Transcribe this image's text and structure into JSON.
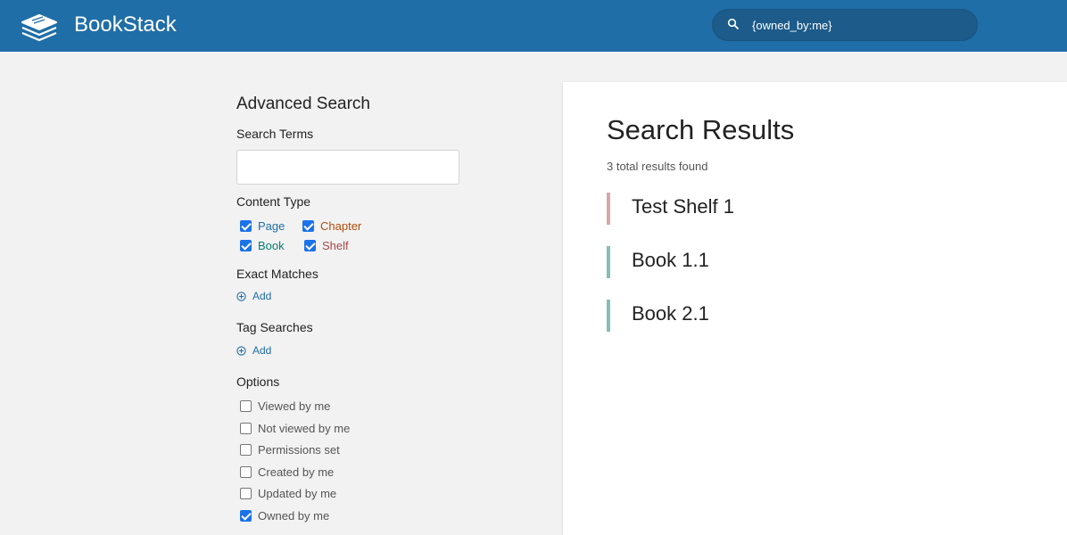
{
  "header": {
    "app_name": "BookStack",
    "search_value": "{owned_by:me}",
    "colors": {
      "header_bg": "#206ea7"
    }
  },
  "sidebar": {
    "title": "Advanced Search",
    "search_terms_label": "Search Terms",
    "search_terms_value": "",
    "content_type_label": "Content Type",
    "content_types": [
      {
        "label": "Page",
        "checked": true,
        "color": "#206ea7"
      },
      {
        "label": "Chapter",
        "checked": true,
        "color": "#af4d0d"
      },
      {
        "label": "Book",
        "checked": true,
        "color": "#077b70"
      },
      {
        "label": "Shelf",
        "checked": true,
        "color": "#a94747"
      }
    ],
    "exact_matches_label": "Exact Matches",
    "exact_add_label": "Add",
    "tag_searches_label": "Tag Searches",
    "tag_add_label": "Add",
    "options_label": "Options",
    "options": [
      {
        "label": "Viewed by me",
        "checked": false
      },
      {
        "label": "Not viewed by me",
        "checked": false
      },
      {
        "label": "Permissions set",
        "checked": false
      },
      {
        "label": "Created by me",
        "checked": false
      },
      {
        "label": "Updated by me",
        "checked": false
      },
      {
        "label": "Owned by me",
        "checked": true
      }
    ]
  },
  "results": {
    "title": "Search Results",
    "count_text": "3 total results found",
    "items": [
      {
        "title": "Test Shelf 1",
        "type": "shelf",
        "accent": "#d8a6a6"
      },
      {
        "title": "Book 1.1",
        "type": "book",
        "accent": "#86bdb6"
      },
      {
        "title": "Book 2.1",
        "type": "book",
        "accent": "#86bdb6"
      }
    ]
  }
}
